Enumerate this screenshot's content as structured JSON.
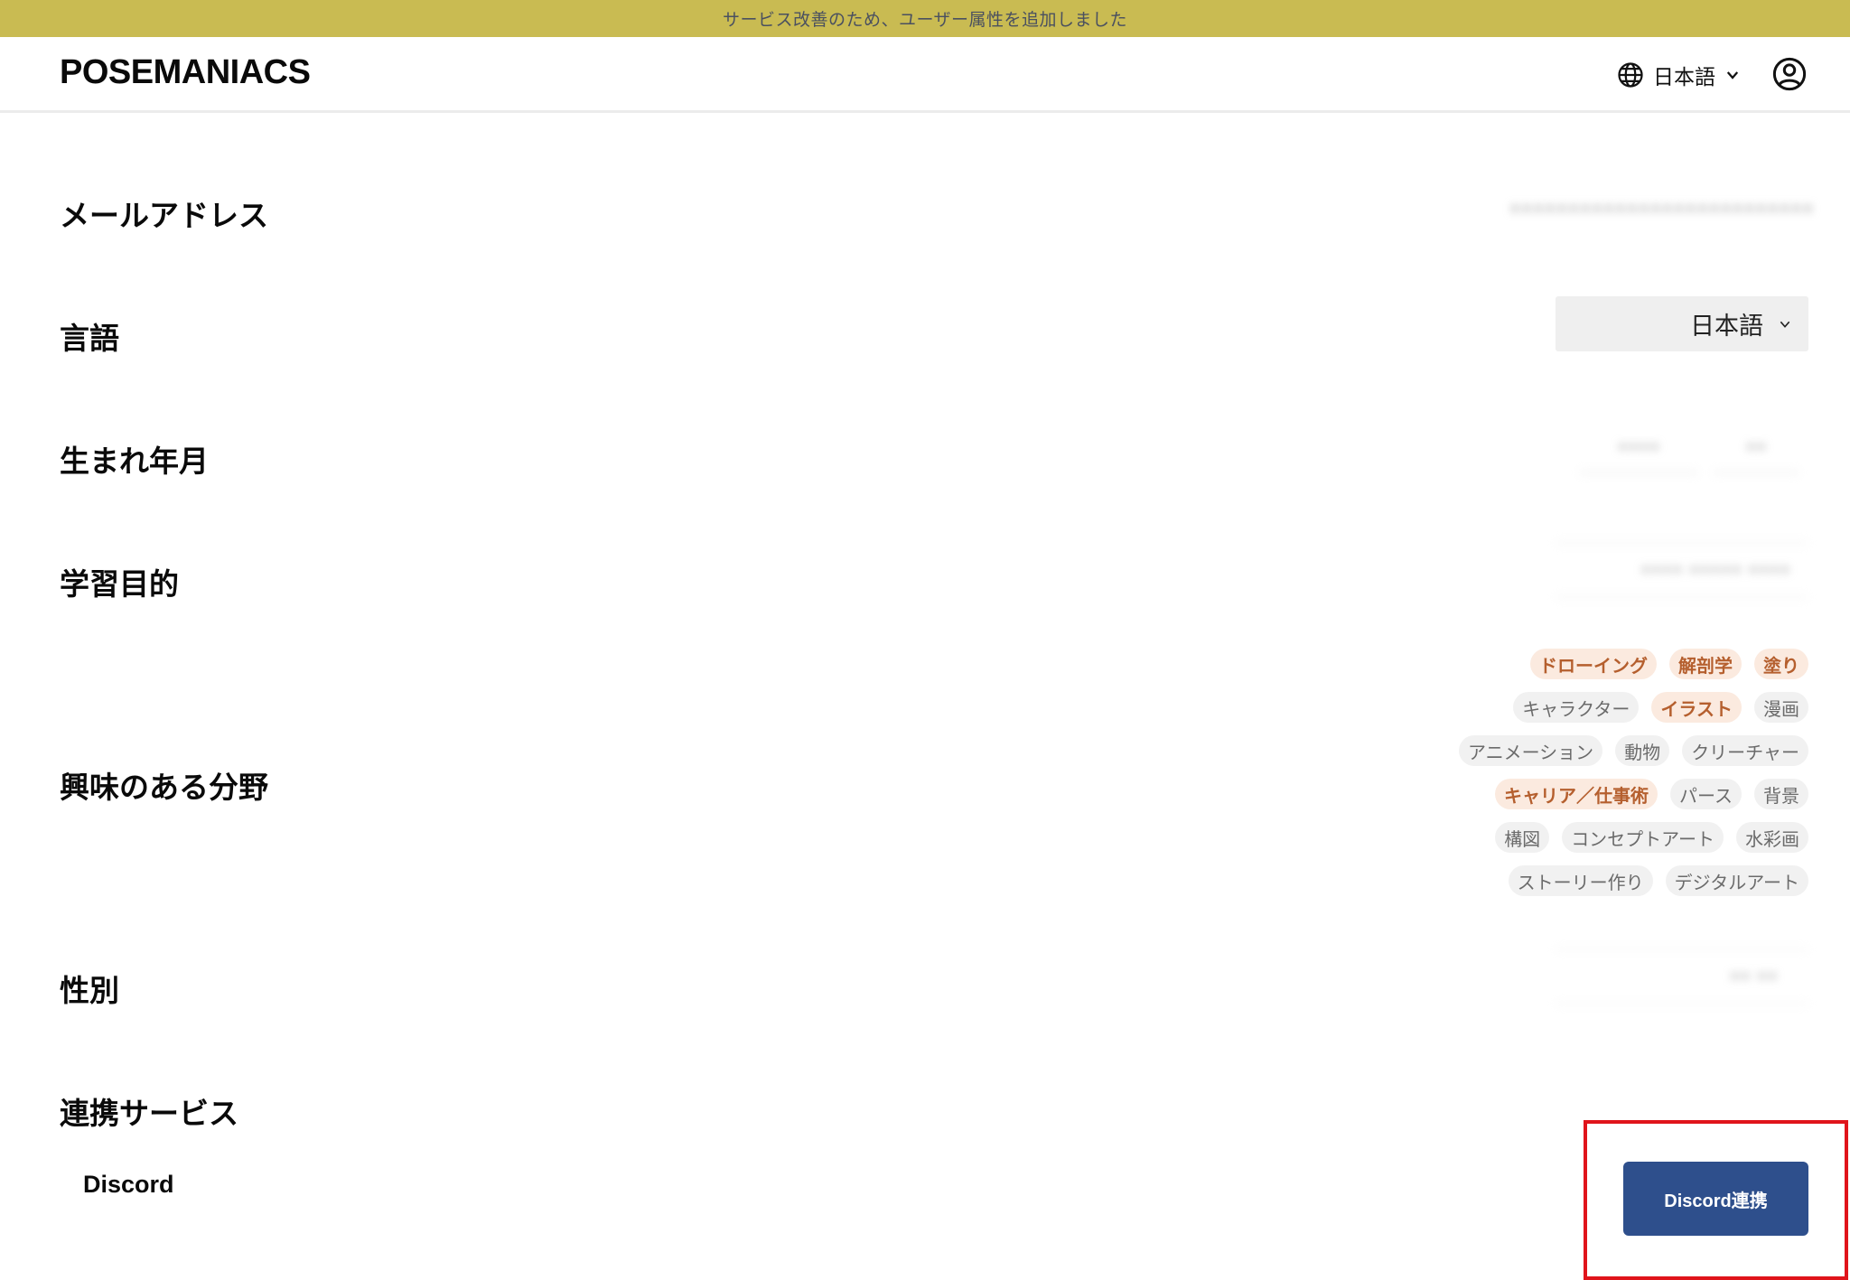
{
  "banner": {
    "text": "サービス改善のため、ユーザー属性を追加しました"
  },
  "header": {
    "logo": "POSEMANIACS",
    "language_label": "日本語"
  },
  "fields": {
    "email": {
      "label": "メールアドレス",
      "value": "••••••••••••••••••••••••••"
    },
    "language": {
      "label": "言語",
      "value": "日本語"
    },
    "birth": {
      "label": "生まれ年月",
      "year": "••••",
      "month": "••"
    },
    "purpose": {
      "label": "学習目的",
      "value": "•••• ••••• ••••"
    },
    "interests": {
      "label": "興味のある分野",
      "rows": [
        [
          {
            "text": "ドローイング",
            "selected": true
          },
          {
            "text": "解剖学",
            "selected": true
          },
          {
            "text": "塗り",
            "selected": true
          }
        ],
        [
          {
            "text": "キャラクター",
            "selected": false
          },
          {
            "text": "イラスト",
            "selected": true
          },
          {
            "text": "漫画",
            "selected": false
          }
        ],
        [
          {
            "text": "アニメーション",
            "selected": false
          },
          {
            "text": "動物",
            "selected": false
          },
          {
            "text": "クリーチャー",
            "selected": false
          }
        ],
        [
          {
            "text": "キャリア／仕事術",
            "selected": true
          },
          {
            "text": "パース",
            "selected": false
          },
          {
            "text": "背景",
            "selected": false
          }
        ],
        [
          {
            "text": "構図",
            "selected": false
          },
          {
            "text": "コンセプトアート",
            "selected": false
          },
          {
            "text": "水彩画",
            "selected": false
          }
        ],
        [
          {
            "text": "ストーリー作り",
            "selected": false
          },
          {
            "text": "デジタルアート",
            "selected": false
          }
        ]
      ]
    },
    "gender": {
      "label": "性別",
      "value": "•• ••"
    },
    "linked_services": {
      "label": "連携サービス",
      "services": [
        {
          "name": "Discord",
          "button_label": "Discord連携"
        }
      ]
    }
  },
  "colors": {
    "banner": "#c9bb52",
    "accent_button": "#2e4f8c",
    "tag_selected_bg": "#fbeadf",
    "tag_selected_text": "#b55f2e",
    "highlight": "#e0141b"
  }
}
